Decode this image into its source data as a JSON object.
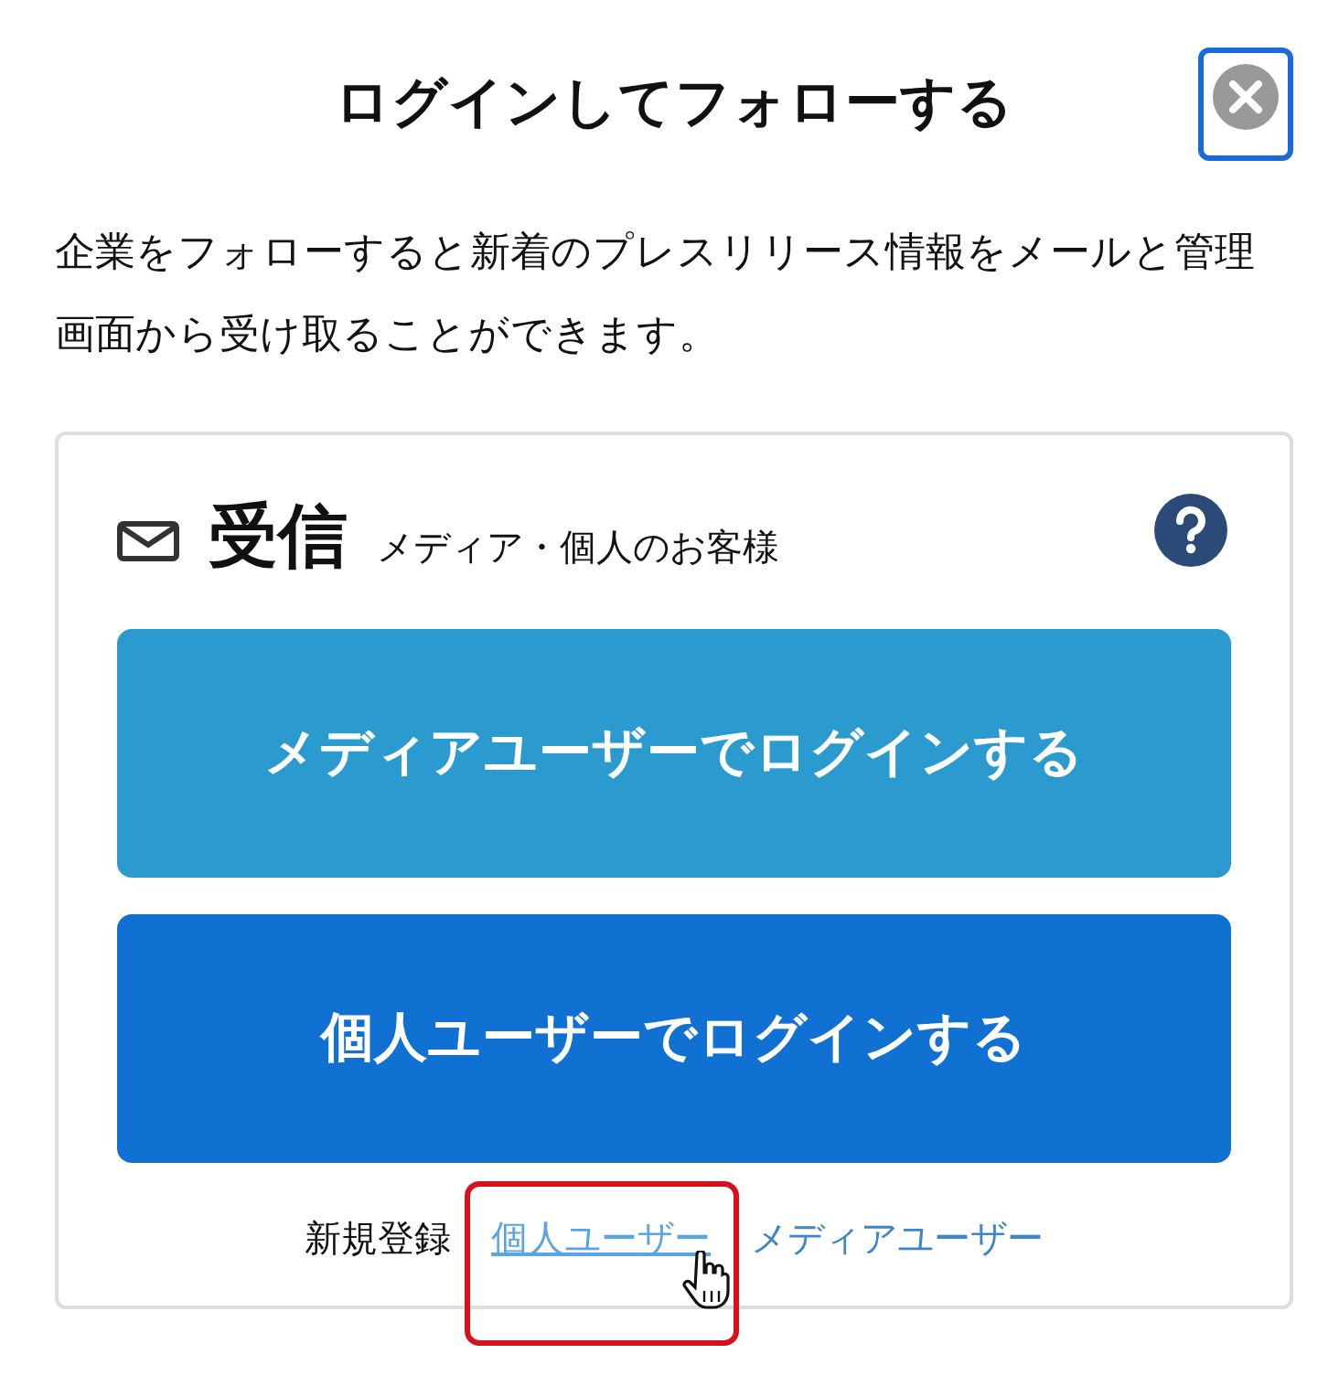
{
  "dialog": {
    "title": "ログインしてフォローする",
    "close_focused": true,
    "description": "企業をフォローすると新着のプレスリリース情報をメールと管理画面から受け取ることができます。"
  },
  "card": {
    "heading": "受信",
    "subheading": "メディア・個人のお客様",
    "buttons": [
      {
        "label": "メディアユーザーでログインする",
        "kind": "media"
      },
      {
        "label": "個人ユーザーでログインする",
        "kind": "personal"
      }
    ],
    "register": {
      "label": "新規登録",
      "links": [
        {
          "label": "個人ユーザー",
          "hovered": true,
          "highlighted": true
        },
        {
          "label": "メディアユーザー",
          "hovered": false,
          "highlighted": false
        }
      ]
    }
  }
}
